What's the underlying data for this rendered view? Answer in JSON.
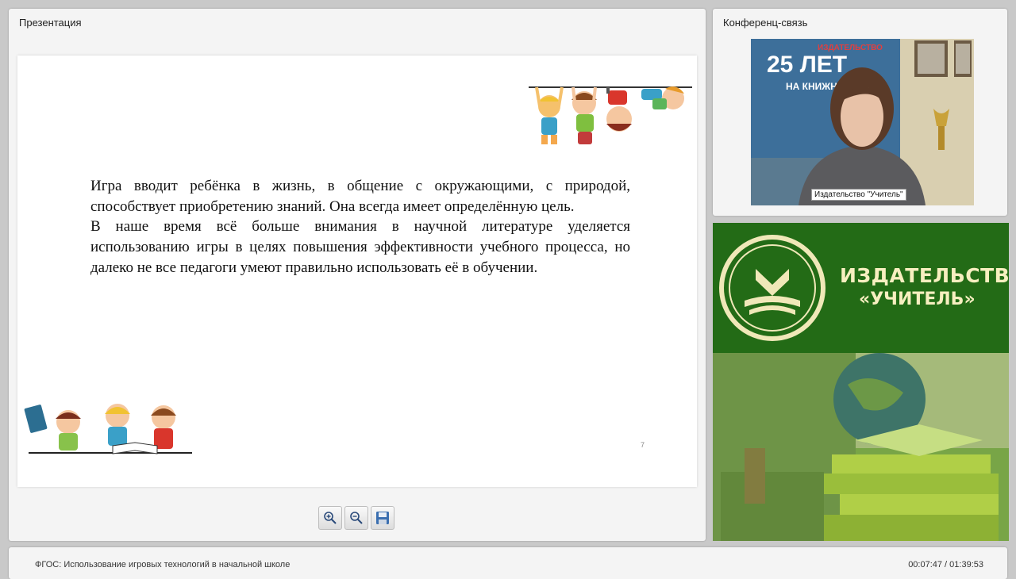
{
  "presentation": {
    "title": "Презентация",
    "slide": {
      "paragraph1": "Игра вводит ребёнка в жизнь, в общение с окружающими, с природой, способствует приобретению знаний. Она всегда имеет определённую цель.",
      "paragraph2": "В наше время всё больше внимания в научной литературе уделяется использованию игры в целях повышения эффективности учебного процесса, но далеко не все педагоги умеют правильно использовать её в обучении.",
      "page_number": "7"
    },
    "toolbar": {
      "zoom_in_icon": "zoom-in-icon",
      "zoom_out_icon": "zoom-out-icon",
      "save_icon": "save-icon"
    }
  },
  "conference": {
    "title": "Конференц-связь",
    "video_label": "Издательство \"Учитель\"",
    "poster_line1": "ИЗДАТЕЛЬСТВО",
    "poster_line2": "25 ЛЕТ",
    "poster_line3": "НА КНИЖНОМ"
  },
  "banner": {
    "line1": "ИЗДАТЕЛЬСТВО",
    "line2": "«УЧИТЕЛЬ»",
    "color": "#236b16"
  },
  "footer": {
    "course_title": "ФГОС: Использование игровых технологий в начальной школе",
    "time": "00:07:47 / 01:39:53"
  }
}
